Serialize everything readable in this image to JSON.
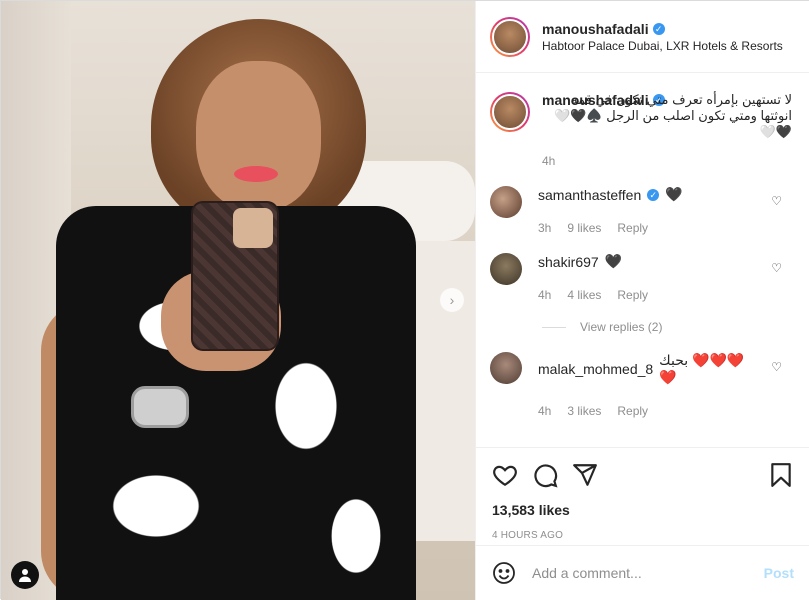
{
  "post": {
    "username": "manoushafadali",
    "location": "Habtoor Palace Dubai, LXR Hotels & Resorts",
    "caption": "لا تستهين بإمرأه تعرف متي تكون في قمه انوثتها ومتي تكون اصلب من الرجل ♠️🖤🤍🖤🤍",
    "caption_time": "4h",
    "likes": "13,583 likes",
    "posted": "4 HOURS AGO"
  },
  "comments": [
    {
      "user": "samanthasteffen",
      "verified": true,
      "text": "🖤",
      "time": "3h",
      "likes": "9 likes",
      "reply": "Reply"
    },
    {
      "user": "shakir697",
      "verified": false,
      "text": "🖤",
      "time": "4h",
      "likes": "4 likes",
      "reply": "Reply",
      "view_replies": "View replies (2)"
    },
    {
      "user": "malak_mohmed_8",
      "verified": false,
      "text": "بحبك ❤️❤️❤️❤️",
      "time": "4h",
      "likes": "3 likes",
      "reply": "Reply"
    }
  ],
  "compose": {
    "placeholder": "Add a comment...",
    "post_label": "Post"
  },
  "colors": {
    "link_blue": "#3897f0",
    "muted": "#8e8e8e",
    "post_disabled": "#b2dffc"
  },
  "icons": [
    "next-arrow-icon",
    "user-tag-icon",
    "heart-icon",
    "comment-icon",
    "share-icon",
    "bookmark-icon",
    "emoji-icon",
    "verified-icon"
  ]
}
